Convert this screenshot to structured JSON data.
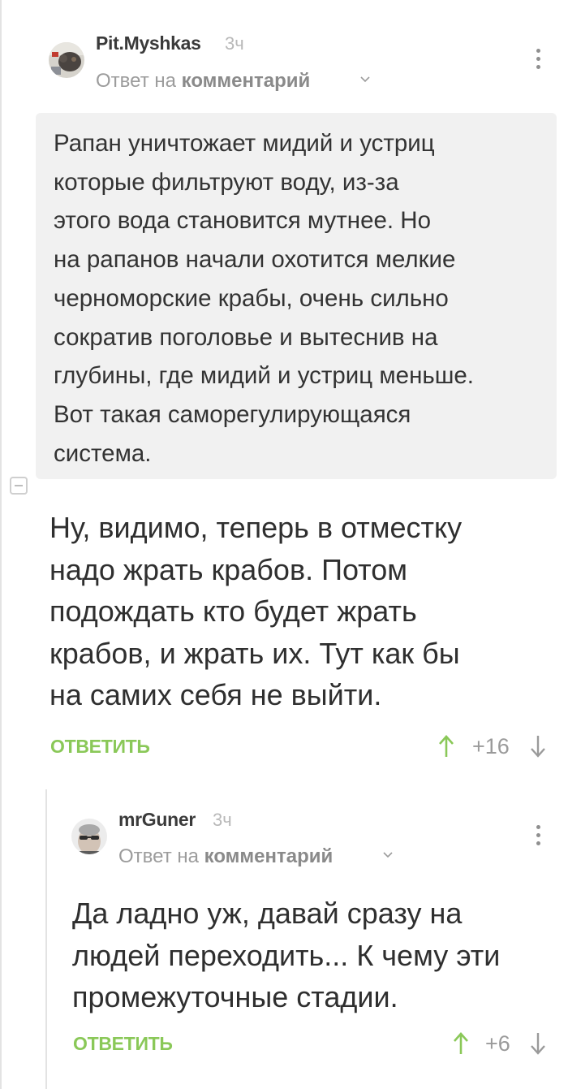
{
  "comments": [
    {
      "author": "Pit.Myshkas",
      "time": "3ч",
      "reply_prefix": "Ответ на",
      "reply_target": "комментарий",
      "quote": [
        "Рапан уничтожает мидий и устриц",
        "которые фильтруют воду, из-за",
        "этого вода становится мутнее. Но",
        "на рапанов начали охотится мелкие",
        "черноморские крабы, очень сильно",
        "сократив поголовье и вытеснив на",
        "глубины, где мидий и устриц меньше.",
        "Вот такая саморегулирующаяся",
        "система."
      ],
      "text": [
        "Ну, видимо, теперь в отместку",
        "надо жрать крабов. Потом",
        "подождать кто будет жрать",
        "крабов, и жрать их. Тут как бы",
        "на самих себя не выйти."
      ],
      "reply_label": "ОТВЕТИТЬ",
      "score": "+16"
    },
    {
      "author": "mrGuner",
      "time": "3ч",
      "reply_prefix": "Ответ на",
      "reply_target": "комментарий",
      "text": [
        "Да ладно уж, давай сразу на",
        "людей переходить... К чему эти",
        "промежуточные стадии."
      ],
      "reply_label": "ОТВЕТИТЬ",
      "score": "+6"
    }
  ],
  "icons": {
    "more": "more-vertical-icon",
    "vote_up": "arrow-up-icon",
    "vote_down": "arrow-down-icon",
    "chevron": "chevron-down-icon",
    "collapse": "collapse-minus-icon"
  },
  "colors": {
    "accent_green": "#8ac858",
    "quote_bg": "#f1f1f1",
    "thread_line": "#e3e3e3"
  }
}
